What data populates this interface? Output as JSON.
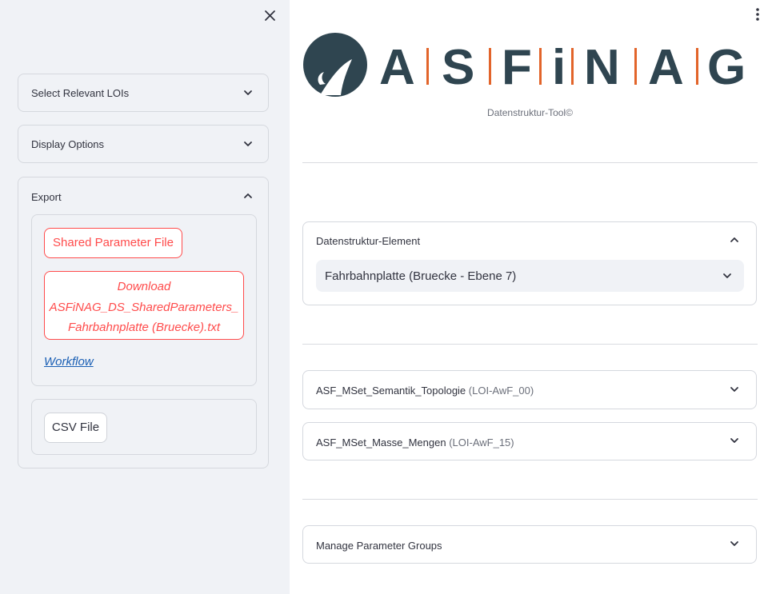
{
  "sidebar": {
    "close_icon": "close-icon",
    "expanders": {
      "select_lois": {
        "title": "Select Relevant LOIs",
        "state": "collapsed"
      },
      "display_options": {
        "title": "Display Options",
        "state": "collapsed"
      },
      "export": {
        "title": "Export",
        "state": "expanded",
        "shared_parameter_button": "Shared Parameter File",
        "download_button_lines": [
          "Download",
          "ASFiNAG_DS_SharedParameters_",
          "Fahrbahnplatte (Bruecke).txt"
        ],
        "workflow_link": "Workflow",
        "csv_button": "CSV File"
      }
    }
  },
  "header": {
    "menu_icon": "kebab-menu-icon"
  },
  "main": {
    "logo_text": "ASFiNAG",
    "subtitle": "Datenstruktur-Tool©",
    "element_section": {
      "title": "Datenstruktur-Element",
      "selected": "Fahrbahnplatte (Bruecke - Ebene 7)"
    },
    "msets": [
      {
        "name": "ASF_MSet_Semantik_Topologie",
        "code": "(LOI-AwF_00)"
      },
      {
        "name": "ASF_MSet_Masse_Mengen",
        "code": "(LOI-AwF_15)"
      }
    ],
    "manage_groups": "Manage Parameter Groups"
  },
  "colors": {
    "sidebar_bg": "#f0f2f6",
    "accent_red": "#ff4b4b",
    "logo_dark": "#2f4550",
    "logo_orange": "#e2642a",
    "link_blue": "#1a5fb4"
  }
}
